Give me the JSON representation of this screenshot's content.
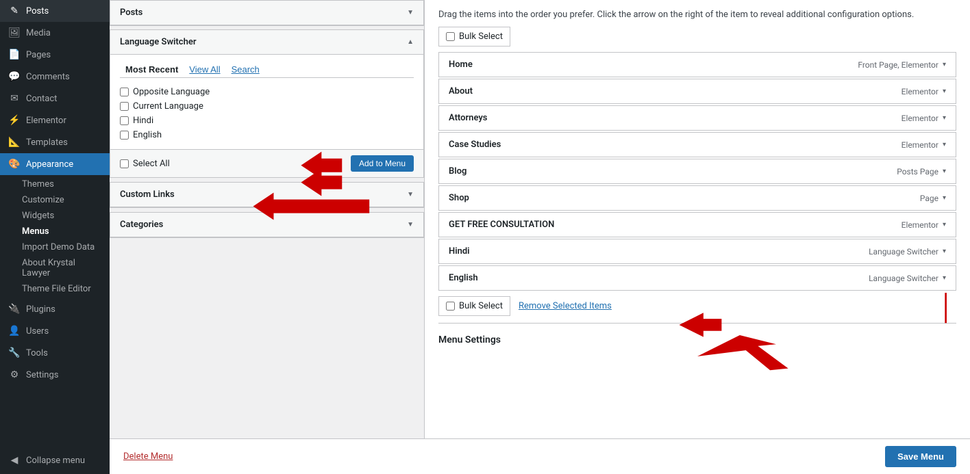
{
  "sidebar": {
    "items": [
      {
        "id": "posts",
        "label": "Posts",
        "icon": "✎"
      },
      {
        "id": "media",
        "label": "Media",
        "icon": "🖼"
      },
      {
        "id": "pages",
        "label": "Pages",
        "icon": "📄"
      },
      {
        "id": "comments",
        "label": "Comments",
        "icon": "💬"
      },
      {
        "id": "contact",
        "label": "Contact",
        "icon": "✉"
      },
      {
        "id": "elementor",
        "label": "Elementor",
        "icon": "⚡"
      },
      {
        "id": "templates",
        "label": "Templates",
        "icon": "📐"
      },
      {
        "id": "appearance",
        "label": "Appearance",
        "icon": "🎨",
        "active": true
      },
      {
        "id": "plugins",
        "label": "Plugins",
        "icon": "🔌"
      },
      {
        "id": "users",
        "label": "Users",
        "icon": "👤"
      },
      {
        "id": "tools",
        "label": "Tools",
        "icon": "🔧"
      },
      {
        "id": "settings",
        "label": "Settings",
        "icon": "⚙"
      }
    ],
    "appearance_sub": [
      {
        "id": "themes",
        "label": "Themes"
      },
      {
        "id": "customize",
        "label": "Customize"
      },
      {
        "id": "widgets",
        "label": "Widgets"
      },
      {
        "id": "menus",
        "label": "Menus",
        "active": true
      },
      {
        "id": "import-demo",
        "label": "Import Demo Data"
      },
      {
        "id": "about-krystal",
        "label": "About Krystal Lawyer"
      },
      {
        "id": "theme-file-editor",
        "label": "Theme File Editor"
      }
    ],
    "collapse_label": "Collapse menu"
  },
  "left_panel": {
    "posts_section": {
      "label": "Posts",
      "collapsed": true
    },
    "language_switcher": {
      "label": "Language Switcher",
      "expanded": true,
      "tabs": [
        {
          "id": "most-recent",
          "label": "Most Recent",
          "active": true
        },
        {
          "id": "view-all",
          "label": "View All"
        },
        {
          "id": "search",
          "label": "Search"
        }
      ],
      "checkboxes": [
        {
          "id": "opposite-lang",
          "label": "Opposite Language",
          "checked": false
        },
        {
          "id": "current-lang",
          "label": "Current Language",
          "checked": false
        },
        {
          "id": "hindi",
          "label": "Hindi",
          "checked": false
        },
        {
          "id": "english",
          "label": "English",
          "checked": false
        }
      ],
      "select_all_label": "Select All",
      "add_button": "Add to Menu"
    },
    "custom_links": {
      "label": "Custom Links",
      "collapsed": true
    },
    "categories": {
      "label": "Categories",
      "collapsed": true
    }
  },
  "right_panel": {
    "instruction": "Drag the items into the order you prefer. Click the arrow on the right of the item to reveal additional configuration options.",
    "bulk_select_label": "Bulk Select",
    "menu_items": [
      {
        "id": "home",
        "name": "Home",
        "type": "Front Page, Elementor"
      },
      {
        "id": "about",
        "name": "About",
        "type": "Elementor"
      },
      {
        "id": "attorneys",
        "name": "Attorneys",
        "type": "Elementor"
      },
      {
        "id": "case-studies",
        "name": "Case Studies",
        "type": "Elementor"
      },
      {
        "id": "blog",
        "name": "Blog",
        "type": "Posts Page"
      },
      {
        "id": "shop",
        "name": "Shop",
        "type": "Page"
      },
      {
        "id": "get-free-consultation",
        "name": "GET FREE CONSULTATION",
        "type": "Elementor"
      },
      {
        "id": "hindi",
        "name": "Hindi",
        "type": "Language Switcher"
      },
      {
        "id": "english",
        "name": "English",
        "type": "Language Switcher"
      }
    ],
    "bottom_bulk_select": "Bulk Select",
    "remove_selected": "Remove Selected Items",
    "menu_settings_heading": "Menu Settings"
  },
  "bottom_bar": {
    "delete_label": "Delete Menu",
    "save_label": "Save Menu"
  }
}
